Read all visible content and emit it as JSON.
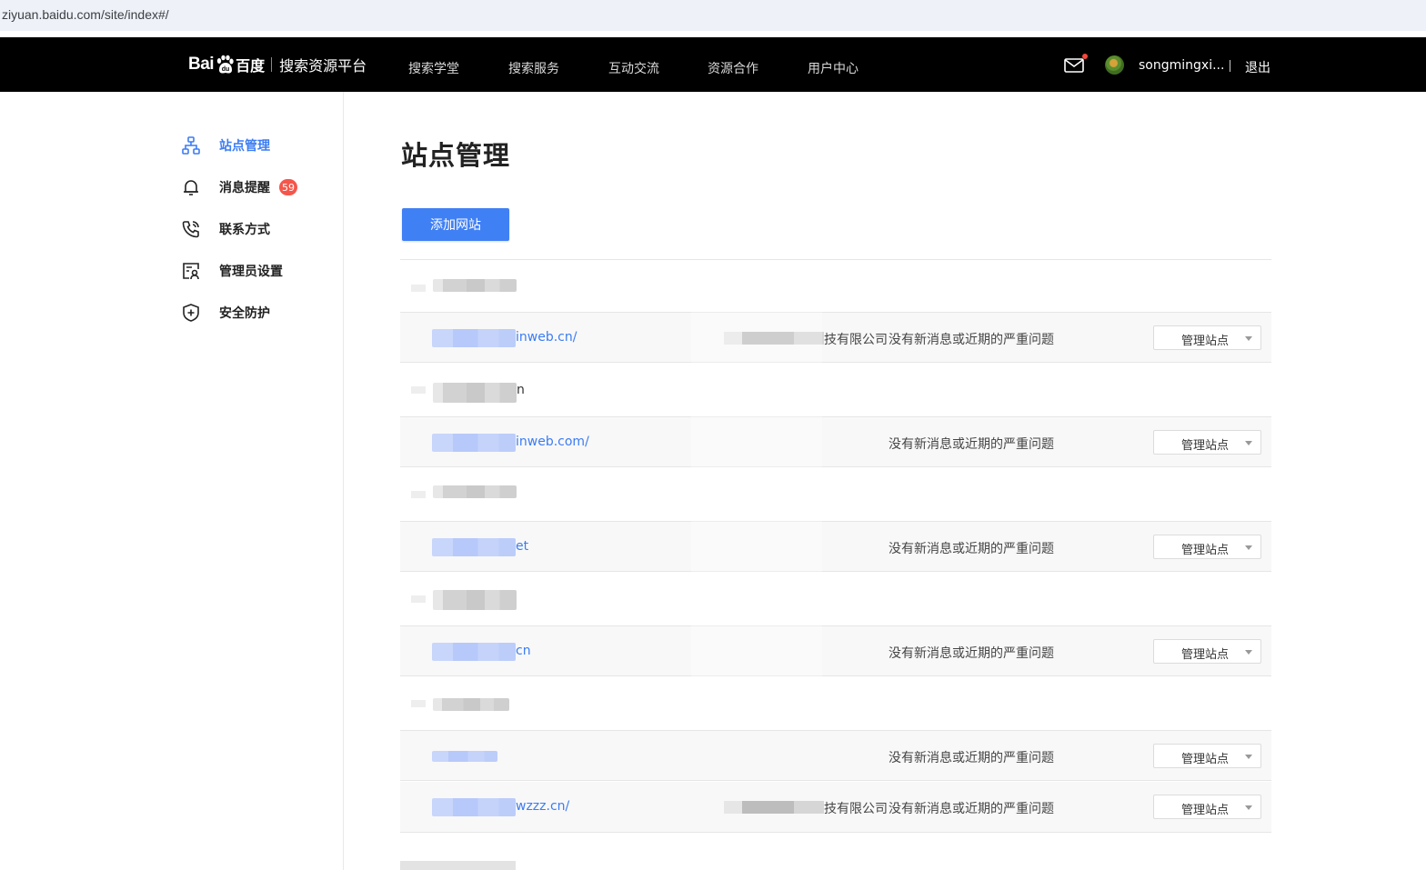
{
  "browser": {
    "url": "ziyuan.baidu.com/site/index#/"
  },
  "header": {
    "logo_bai": "Bai",
    "logo_cn": "百度",
    "platform": "搜索资源平台",
    "nav": [
      {
        "label": "搜索学堂"
      },
      {
        "label": "搜索服务"
      },
      {
        "label": "互动交流"
      },
      {
        "label": "资源合作"
      },
      {
        "label": "用户中心"
      }
    ],
    "mail_icon": "mail-icon",
    "username": "songmingxi...",
    "logout": "退出"
  },
  "sidebar": {
    "items": [
      {
        "label": "站点管理",
        "icon": "sitemap-icon",
        "active": true
      },
      {
        "label": "消息提醒",
        "icon": "bell-icon",
        "badge": "59"
      },
      {
        "label": "联系方式",
        "icon": "phone-icon"
      },
      {
        "label": "管理员设置",
        "icon": "admin-card-icon"
      },
      {
        "label": "安全防护",
        "icon": "shield-plus-icon"
      }
    ]
  },
  "main": {
    "title": "站点管理",
    "add_button": "添加网站",
    "groups": [
      {
        "name": "",
        "sites": [
          {
            "url_suffix": "inweb.cn/",
            "owner_suffix": "技有限公司",
            "status": "没有新消息或近期的严重问题",
            "action": "管理站点"
          }
        ]
      },
      {
        "name": "n",
        "sites": [
          {
            "url_suffix": "inweb.com/",
            "owner_suffix": "",
            "status": "没有新消息或近期的严重问题",
            "action": "管理站点"
          }
        ]
      },
      {
        "name": "",
        "sites": [
          {
            "url_suffix": "et",
            "owner_suffix": "",
            "status": "没有新消息或近期的严重问题",
            "action": "管理站点"
          }
        ]
      },
      {
        "name": "",
        "sites": [
          {
            "url_suffix": "cn",
            "owner_suffix": "",
            "status": "没有新消息或近期的严重问题",
            "action": "管理站点"
          }
        ]
      },
      {
        "name": "",
        "sites": [
          {
            "url_suffix": "",
            "owner_suffix": "",
            "status": "没有新消息或近期的严重问题",
            "action": "管理站点"
          },
          {
            "url_suffix": "wzzz.cn/",
            "owner_suffix": "技有限公司",
            "status": "没有新消息或近期的严重问题",
            "action": "管理站点"
          }
        ]
      }
    ]
  },
  "colors": {
    "accent": "#4080f5",
    "link": "#3b7cf3",
    "badge": "#f5564b",
    "nav_bg": "#000000"
  }
}
